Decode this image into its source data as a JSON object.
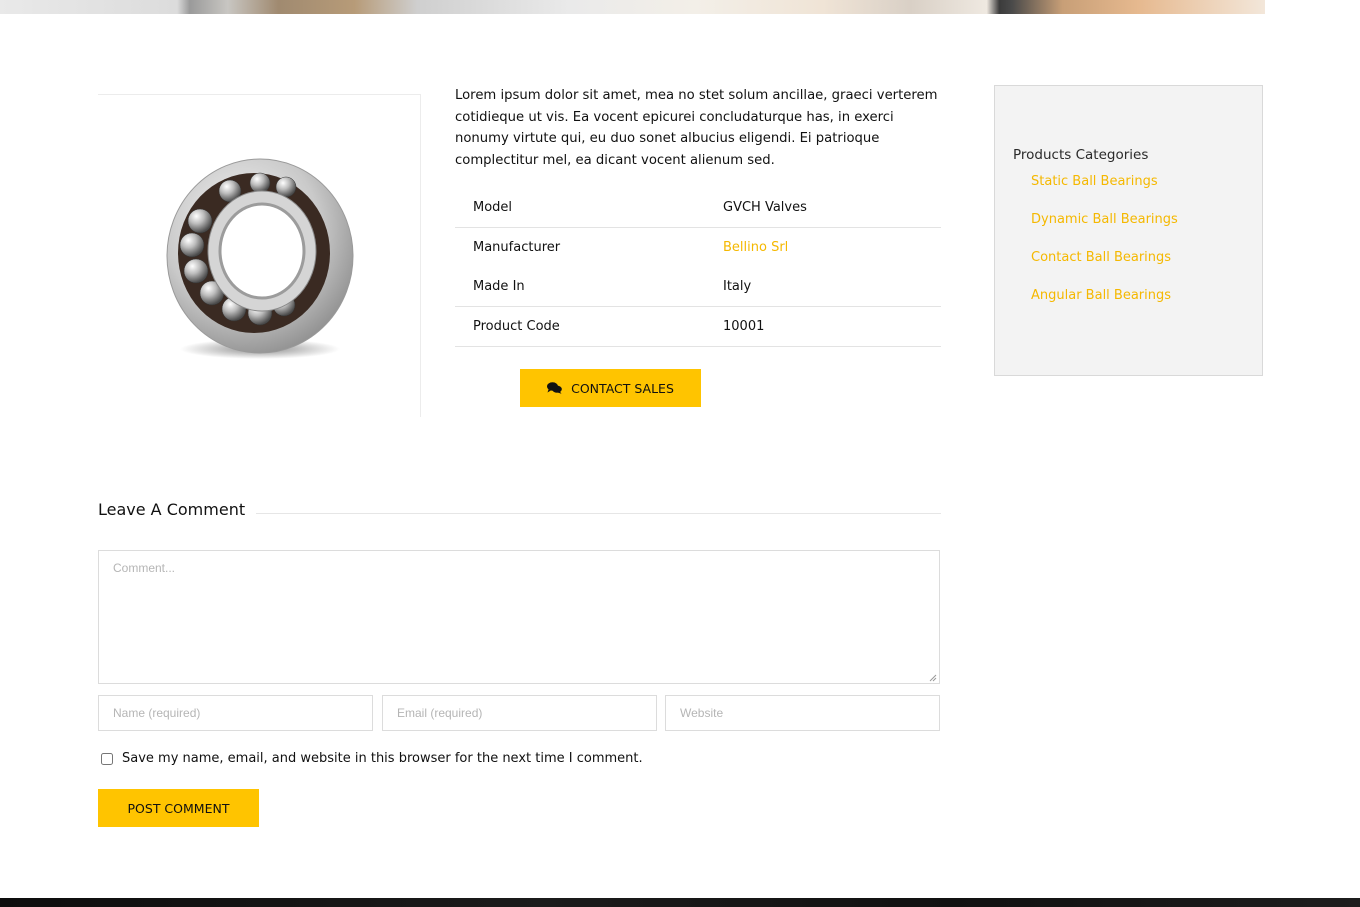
{
  "product": {
    "description": "Lorem ipsum dolor sit amet, mea no stet solum ancillae, graeci verterem cotidieque ut vis. Ea vocent epicurei concludaturque has, in exerci nonumy virtute qui, eu duo sonet albucius eligendi. Ei patrioque complectitur mel, ea dicant vocent alienum sed.",
    "specs": [
      {
        "label": "Model",
        "value": "GVCH Valves"
      },
      {
        "label": "Manufacturer",
        "value": "Bellino Srl"
      },
      {
        "label": "Made In",
        "value": "Italy"
      },
      {
        "label": "Product Code",
        "value": "10001"
      }
    ],
    "contact_label": "CONTACT SALES",
    "image_icon": "ball-bearing-image"
  },
  "sidebar": {
    "title": "Products Categories",
    "items": [
      {
        "label": "Static Ball Bearings"
      },
      {
        "label": "Dynamic Ball Bearings"
      },
      {
        "label": "Contact Ball Bearings"
      },
      {
        "label": "Angular Ball Bearings"
      }
    ]
  },
  "comment": {
    "title": "Leave A Comment",
    "comment_placeholder": "Comment...",
    "name_placeholder": "Name (required)",
    "email_placeholder": "Email (required)",
    "website_placeholder": "Website",
    "save_label": "Save my name, email, and website in this browser for the next time I comment.",
    "post_label": "POST COMMENT"
  },
  "colors": {
    "accent": "#ffc400",
    "link": "#f5b800"
  }
}
